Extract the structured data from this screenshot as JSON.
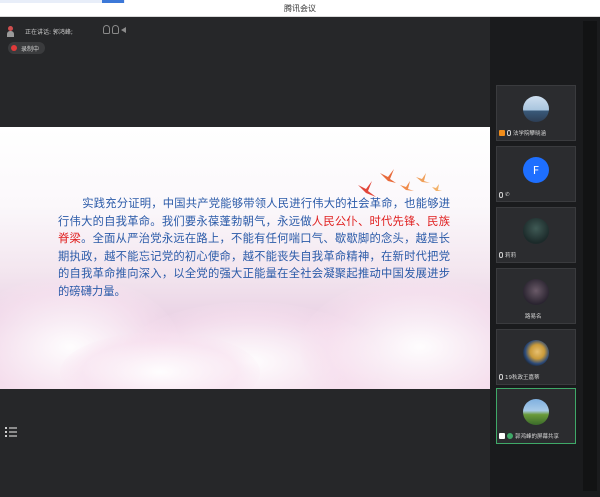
{
  "window": {
    "title": "腾讯会议"
  },
  "stage": {
    "speaking_label": "正在讲话: 郭鸿峰;",
    "recording_label": "录制中"
  },
  "slide": {
    "text_before": "实践充分证明，中国共产党能够带领人民进行伟大的社会革命，也能够进行伟大的自我革命。我们要永葆蓬勃朝气，永远做",
    "text_highlight": "人民公仆、时代先锋、民族脊梁",
    "text_after": "。全面从严治党永远在路上，不能有任何喘口气、歇歇脚的念头，越是长期执政，越不能忘记党的初心使命，越不能丧失自我革命精神，在新时代把党的自我革命推向深入，以全党的强大正能量在全社会凝聚起推动中国发展进步的磅礴力量。",
    "text_color": "#2a5aa8",
    "highlight_color": "#e02020"
  },
  "participants": [
    {
      "name": "法学院攀晓涵",
      "avatar": "landscape"
    },
    {
      "name": "F",
      "avatar": "letter-F"
    },
    {
      "name": "莉莉",
      "avatar": "anime-dark"
    },
    {
      "name": "路易名",
      "avatar": "anime-girl"
    },
    {
      "name": "19秋政王嘉蒂",
      "avatar": "pearl-earring"
    },
    {
      "name": "郭鸿峰的屏幕共享",
      "avatar": "landscape-tree"
    }
  ],
  "icons": {
    "speaker": "person-icon",
    "audio": "speaker-icon",
    "record": "record-dot-icon",
    "list": "list-icon",
    "mic": "mic-icon",
    "screen_share": "screen-share-icon"
  },
  "colors": {
    "recording": "#e03a3a",
    "active_tile_border": "#3fa968",
    "avatar_blue": "#1e6fff"
  }
}
